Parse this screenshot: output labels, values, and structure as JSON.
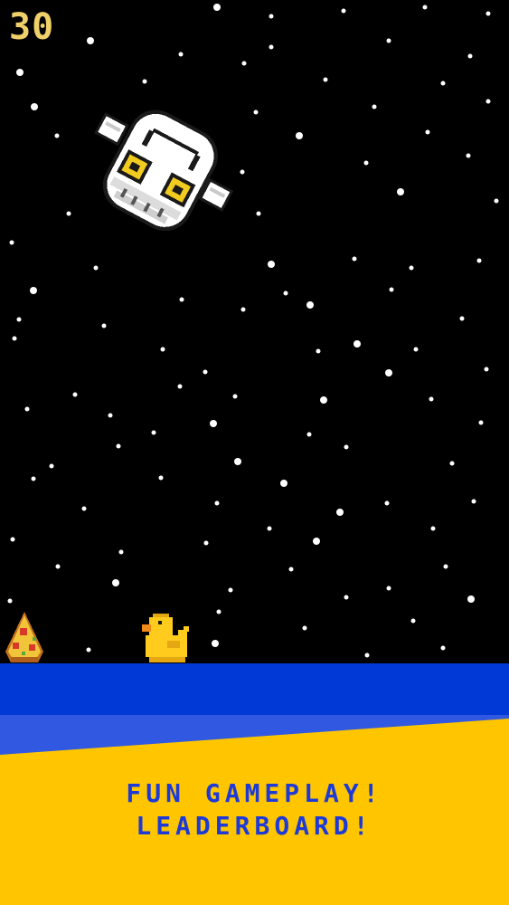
{
  "hud": {
    "score": "30"
  },
  "promo": {
    "line1": "FUN GAMEPLAY!",
    "line2": "LEADERBOARD!"
  },
  "sprites": {
    "enemy": "skull-ghost-icon",
    "player": "rubber-duck-icon",
    "pickup": "pizza-slice-icon"
  },
  "colors": {
    "sky": "#000000",
    "star": "#ffffff",
    "score": "#efd069",
    "water": "#0039d6",
    "water_light": "#3058e0",
    "banner": "#ffc600",
    "promo_text": "#1d3ad8",
    "duck": "#ffcb1c"
  }
}
